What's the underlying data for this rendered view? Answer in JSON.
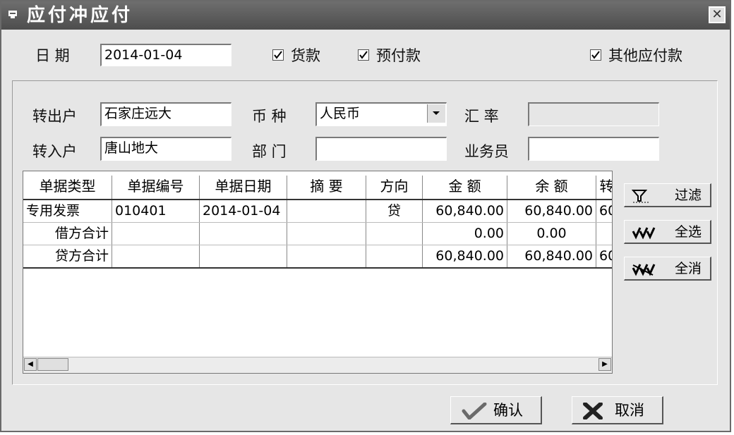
{
  "window": {
    "title": "应付冲应付"
  },
  "top": {
    "date_label": "日  期",
    "date_value": "2014-01-04",
    "check_goods": {
      "label": "货款",
      "checked": true
    },
    "check_prepay": {
      "label": "预付款",
      "checked": true
    },
    "check_other": {
      "label": "其他应付款",
      "checked": true
    }
  },
  "form": {
    "out_label": "转出户",
    "out_value": "石家庄远大",
    "in_label": "转入户",
    "in_value": "唐山地大",
    "currency_label": "币  种",
    "currency_value": "人民币",
    "dept_label": "部  门",
    "dept_value": "",
    "rate_label": "汇  率",
    "rate_value": "",
    "staff_label": "业务员",
    "staff_value": ""
  },
  "grid": {
    "columns": [
      "单据类型",
      "单据编号",
      "单据日期",
      "摘    要",
      "方向",
      "金    额",
      "余    额",
      "转"
    ],
    "rows": [
      [
        "专用发票",
        "010401",
        "2014-01-04",
        "",
        "贷",
        "60,840.00",
        "60,840.00",
        "60"
      ],
      [
        "借方合计",
        "",
        "",
        "",
        "",
        "0.00",
        "0.00",
        ""
      ],
      [
        "贷方合计",
        "",
        "",
        "",
        "",
        "60,840.00",
        "60,840.00",
        "60"
      ]
    ]
  },
  "side_buttons": {
    "filter": "过滤",
    "select_all": "全选",
    "deselect_all": "全消"
  },
  "buttons": {
    "confirm": "确认",
    "cancel": "取消"
  },
  "colors": {
    "title_bg": "#5a5a5a",
    "window_bg": "#e6e6e6"
  }
}
